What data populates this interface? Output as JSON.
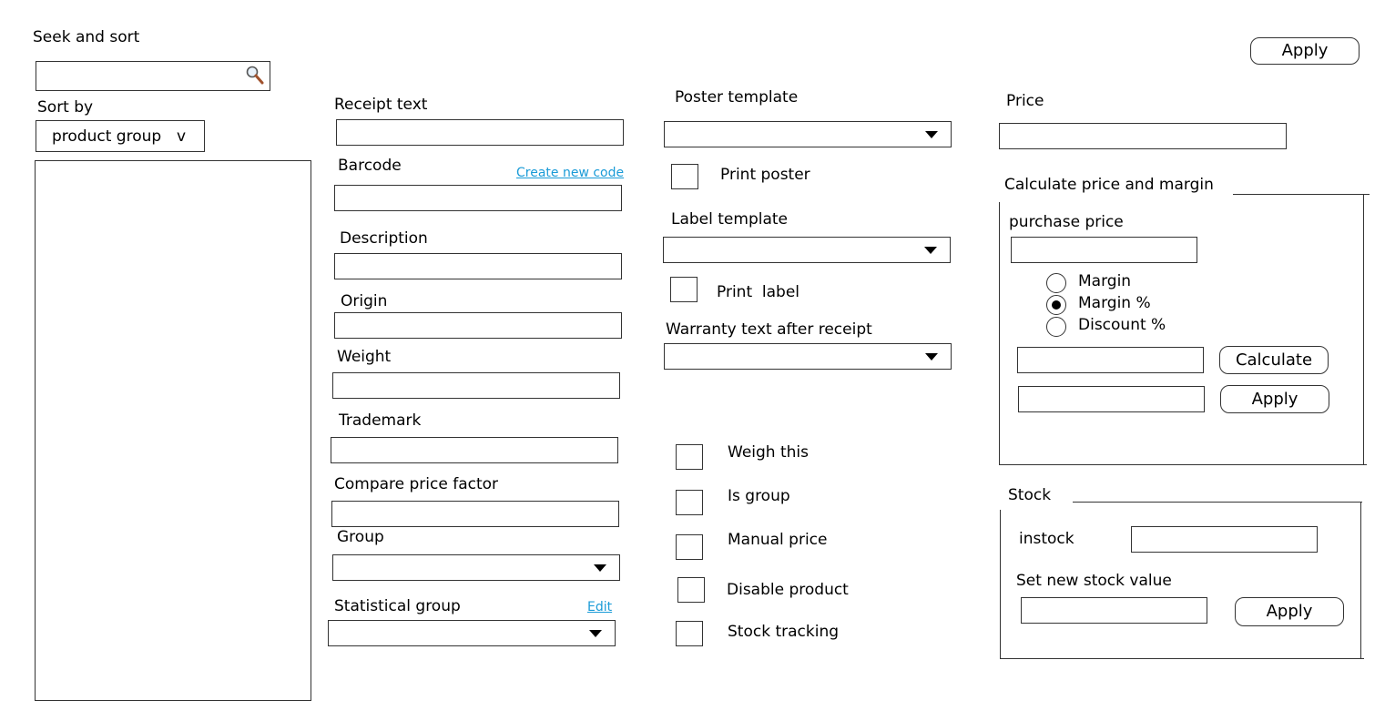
{
  "seek": {
    "title": "Seek and sort",
    "search_value": "",
    "search_icon": "magnifier-icon",
    "sort_label": "Sort by",
    "sort_value": "product group",
    "sort_chevron": "v"
  },
  "top_apply": "Apply",
  "fields": {
    "receipt_text": "Receipt text",
    "barcode": "Barcode",
    "create_new_code": "Create new code",
    "description": "Description",
    "origin": "Origin",
    "weight": "Weight",
    "trademark": "Trademark",
    "compare_price_factor": "Compare price factor",
    "group": "Group",
    "statistical_group": "Statistical group",
    "edit": "Edit"
  },
  "templates": {
    "poster_template": "Poster template",
    "print_poster": "Print poster",
    "label_template": "Label template",
    "print_label": "Print  label",
    "warranty_text": "Warranty text after receipt"
  },
  "flags": {
    "weigh_this": "Weigh this",
    "is_group": "Is group",
    "manual_price": "Manual price",
    "disable_product": "Disable product",
    "stock_tracking": "Stock tracking"
  },
  "price": {
    "label": "Price",
    "calc_title": "Calculate price and margin",
    "purchase_price": "purchase price",
    "options": [
      "Margin",
      "Margin %",
      "Discount %"
    ],
    "selected_option": "Margin %",
    "calculate": "Calculate",
    "apply": "Apply"
  },
  "stock": {
    "title": "Stock",
    "instock": "instock",
    "set_new": "Set new stock value",
    "apply": "Apply"
  }
}
